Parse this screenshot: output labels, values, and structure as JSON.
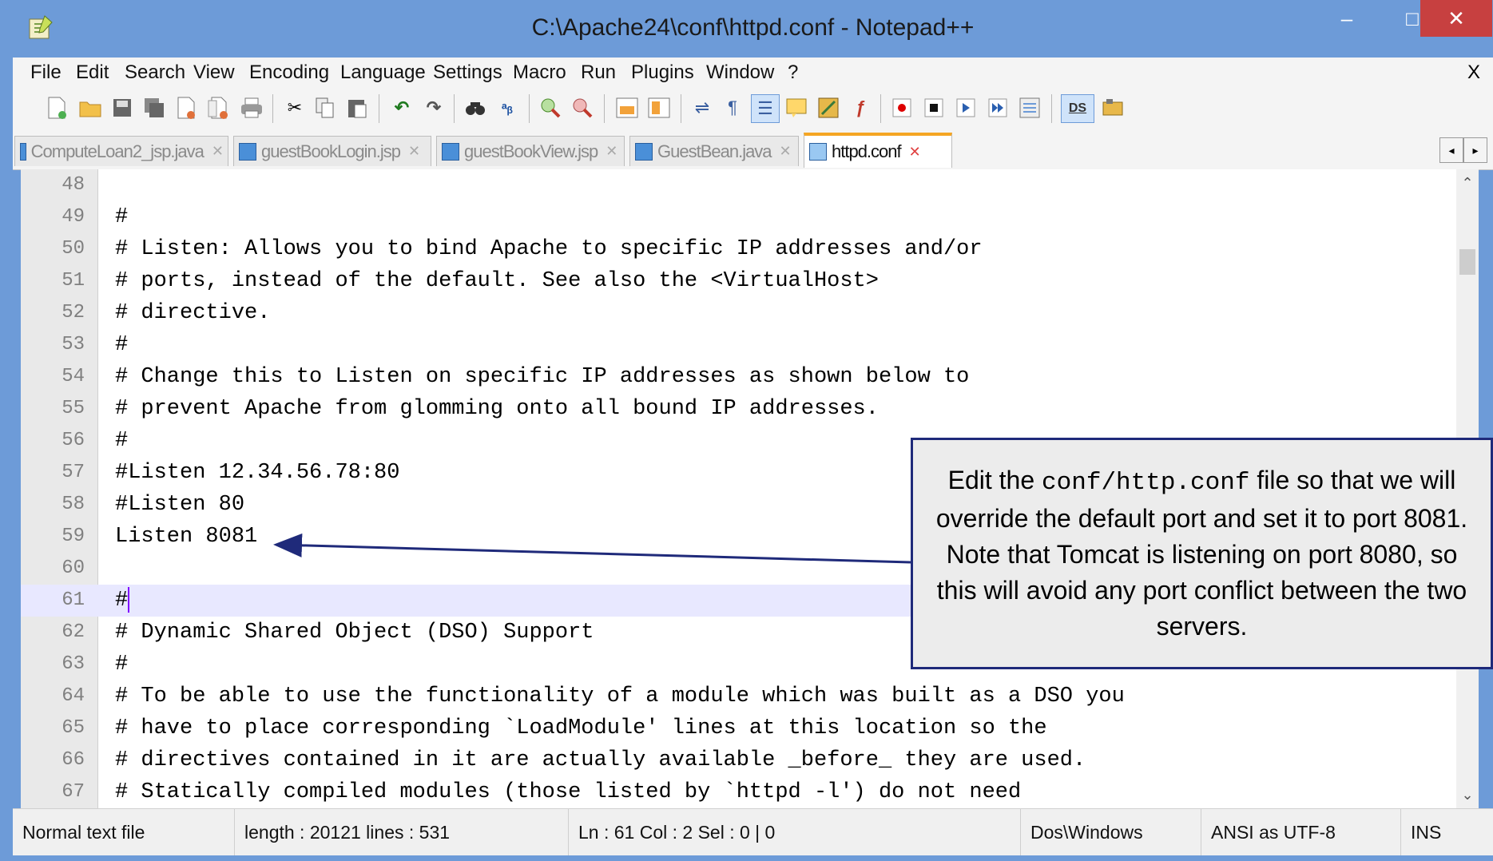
{
  "window": {
    "title": "C:\\Apache24\\conf\\httpd.conf - Notepad++",
    "minimize": "–",
    "maximize": "□",
    "close": "✕"
  },
  "menu": {
    "items": [
      "File",
      "Edit",
      "Search",
      "View",
      "Encoding",
      "Language",
      "Settings",
      "Macro",
      "Run",
      "Plugins",
      "Window",
      "?"
    ],
    "close": "X"
  },
  "toolbar": {
    "icons": [
      "new-file-icon",
      "open-file-icon",
      "save-icon",
      "save-all-icon",
      "close-icon",
      "close-all-icon",
      "print-icon",
      "cut-icon",
      "copy-icon",
      "paste-icon",
      "undo-icon",
      "redo-icon",
      "find-icon",
      "replace-icon",
      "zoom-in-icon",
      "zoom-out-icon",
      "sync-vertical-icon",
      "sync-horizontal-icon",
      "word-wrap-icon",
      "show-all-chars-icon",
      "indent-guide-icon",
      "user-lang-icon",
      "doc-map-icon",
      "function-list-icon",
      "record-macro-icon",
      "stop-macro-icon",
      "play-macro-icon",
      "run-macro-multiple-icon",
      "save-macro-icon",
      "ds-icon",
      "plugin-icon"
    ]
  },
  "tabs": [
    {
      "label": "ComputeLoan2_jsp.java",
      "active": false
    },
    {
      "label": "guestBookLogin.jsp",
      "active": false
    },
    {
      "label": "guestBookView.jsp",
      "active": false
    },
    {
      "label": "GuestBean.java",
      "active": false
    },
    {
      "label": "httpd.conf",
      "active": true
    }
  ],
  "tab_close": "✕",
  "editor": {
    "lines": [
      {
        "n": "48",
        "text": ""
      },
      {
        "n": "49",
        "text": "#"
      },
      {
        "n": "50",
        "text": "# Listen: Allows you to bind Apache to specific IP addresses and/or"
      },
      {
        "n": "51",
        "text": "# ports, instead of the default. See also the <VirtualHost>"
      },
      {
        "n": "52",
        "text": "# directive."
      },
      {
        "n": "53",
        "text": "#"
      },
      {
        "n": "54",
        "text": "# Change this to Listen on specific IP addresses as shown below to"
      },
      {
        "n": "55",
        "text": "# prevent Apache from glomming onto all bound IP addresses."
      },
      {
        "n": "56",
        "text": "#"
      },
      {
        "n": "57",
        "text": "#Listen 12.34.56.78:80"
      },
      {
        "n": "58",
        "text": "#Listen 80"
      },
      {
        "n": "59",
        "text": "Listen 8081"
      },
      {
        "n": "60",
        "text": ""
      },
      {
        "n": "61",
        "text": "#"
      },
      {
        "n": "62",
        "text": "# Dynamic Shared Object (DSO) Support"
      },
      {
        "n": "63",
        "text": "#"
      },
      {
        "n": "64",
        "text": "# To be able to use the functionality of a module which was built as a DSO you"
      },
      {
        "n": "65",
        "text": "# have to place corresponding `LoadModule' lines at this location so the"
      },
      {
        "n": "66",
        "text": "# directives contained in it are actually available _before_ they are used."
      },
      {
        "n": "67",
        "text": "# Statically compiled modules (those listed by `httpd -l') do not need"
      }
    ],
    "current_line": "61"
  },
  "callout": {
    "before": "Edit the ",
    "mono": "conf/http.conf",
    "after": " file so that we will override the default port and set it to port 8081.  Note that Tomcat is listening on port 8080, so this will avoid any port conflict between the two servers."
  },
  "status": {
    "file_type": "Normal text file",
    "length_lines": "length : 20121    lines : 531",
    "position": "Ln : 61    Col : 2    Sel : 0 | 0",
    "eol": "Dos\\Windows",
    "encoding": "ANSI as UTF-8",
    "mode": "INS"
  },
  "colors": {
    "titlebar": "#6d9bd8",
    "close_button": "#c74040",
    "callout_border": "#1f2a7a",
    "current_line": "#e8e8ff"
  }
}
